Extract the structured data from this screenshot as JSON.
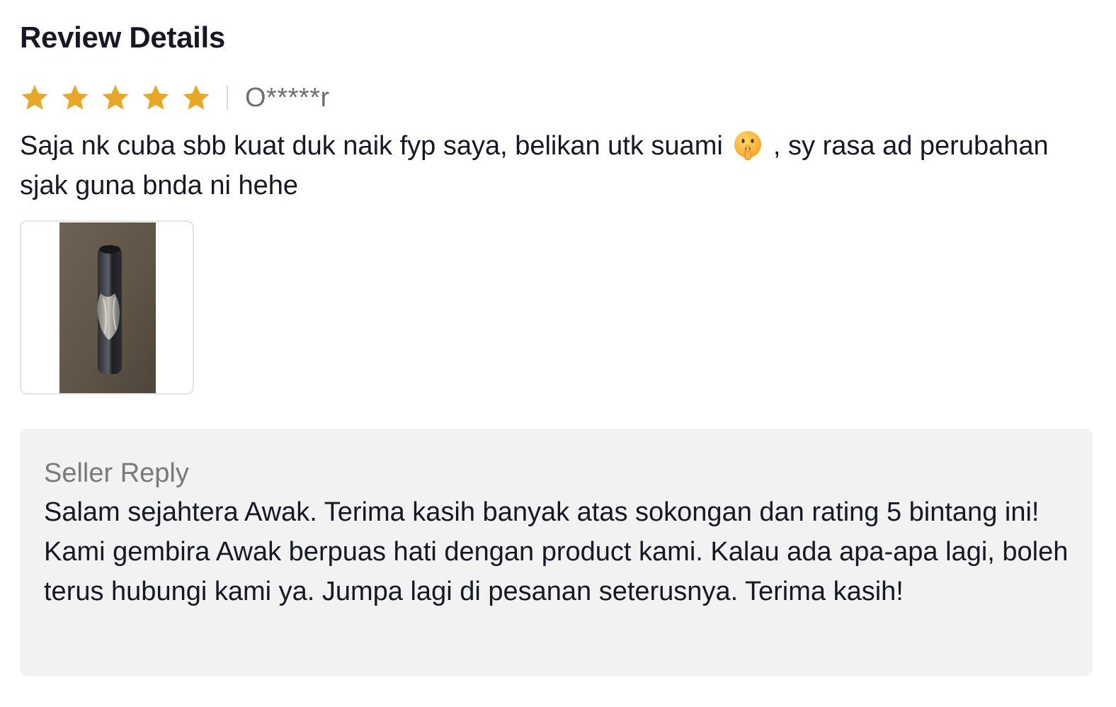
{
  "page": {
    "title": "Review Details"
  },
  "review": {
    "rating": 5,
    "rating_max": 5,
    "star_color": "#E6A826",
    "reviewer": "O*****r",
    "text_before_emoji": "Saja nk cuba sbb kuat duk naik fyp saya, belikan utk suami",
    "emoji": "shushing-face-emoji",
    "text_after_emoji": ", sy rasa ad perubahan sjak guna bnda ni hehe",
    "images": [
      {
        "icon": "product-photo-thumbnail"
      }
    ]
  },
  "seller_reply": {
    "label": "Seller Reply",
    "text": "Salam sejahtera Awak. Terima kasih banyak atas sokongan dan rating 5 bintang ini! Kami gembira Awak berpuas hati dengan product kami. Kalau ada apa-apa lagi, boleh terus hubungi kami ya. Jumpa lagi di pesanan seterusnya. Terima kasih!"
  }
}
